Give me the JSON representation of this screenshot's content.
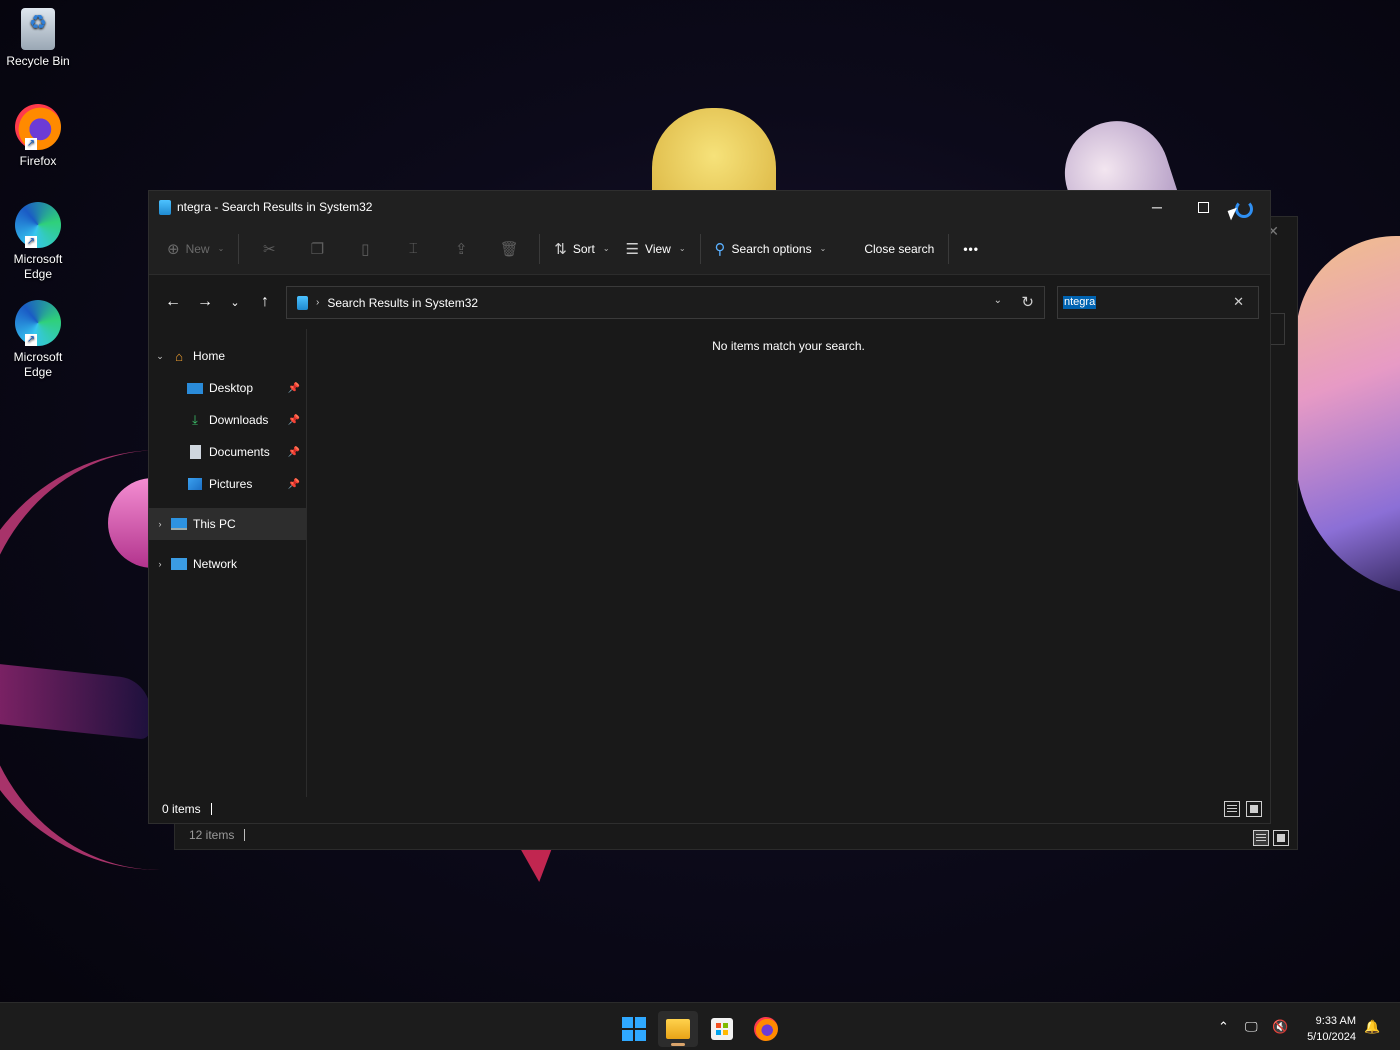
{
  "desktop": {
    "icons": [
      {
        "label": "Recycle Bin"
      },
      {
        "label": "Firefox"
      },
      {
        "label": "Microsoft Edge"
      },
      {
        "label": "Microsoft Edge"
      }
    ]
  },
  "back_window": {
    "status_items": "12 items"
  },
  "window": {
    "title": "ntegra - Search Results in System32",
    "toolbar": {
      "new_label": "New",
      "sort_label": "Sort",
      "view_label": "View",
      "search_options_label": "Search options",
      "close_search_label": "Close search",
      "more_label": "•••"
    },
    "address": {
      "path": "Search Results in System32"
    },
    "search": {
      "value": "ntegra"
    },
    "sidebar": {
      "home": "Home",
      "desktop": "Desktop",
      "downloads": "Downloads",
      "documents": "Documents",
      "pictures": "Pictures",
      "this_pc": "This PC",
      "network": "Network"
    },
    "content": {
      "empty_message": "No items match your search."
    },
    "status": {
      "items": "0 items"
    }
  },
  "taskbar": {
    "time": "9:33 AM",
    "date": "5/10/2024"
  }
}
